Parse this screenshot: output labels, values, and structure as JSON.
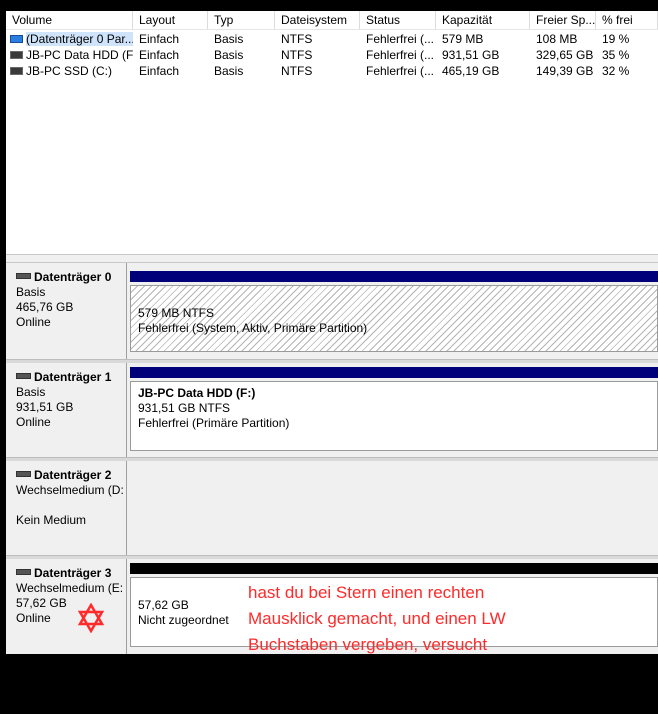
{
  "volume_list": {
    "columns": [
      "Volume",
      "Layout",
      "Typ",
      "Dateisystem",
      "Status",
      "Kapazität",
      "Freier Sp...",
      "% frei"
    ],
    "rows": [
      {
        "volume": "(Datenträger 0 Par...",
        "layout": "Einfach",
        "typ": "Basis",
        "dateisystem": "NTFS",
        "status": "Fehlerfrei (...",
        "kapazitaet": "579 MB",
        "frei": "108 MB",
        "prozent": "19 %",
        "icon": "volume-blue-icon"
      },
      {
        "volume": "JB-PC Data HDD (F:)",
        "layout": "Einfach",
        "typ": "Basis",
        "dateisystem": "NTFS",
        "status": "Fehlerfrei (...",
        "kapazitaet": "931,51 GB",
        "frei": "329,65 GB",
        "prozent": "35 %",
        "icon": "volume-drive-icon"
      },
      {
        "volume": "JB-PC SSD (C:)",
        "layout": "Einfach",
        "typ": "Basis",
        "dateisystem": "NTFS",
        "status": "Fehlerfrei (...",
        "kapazitaet": "465,19 GB",
        "frei": "149,39 GB",
        "prozent": "32 %",
        "icon": "volume-drive-icon"
      }
    ]
  },
  "disks": [
    {
      "name": "Datenträger 0",
      "type": "Basis",
      "size": "465,76 GB",
      "status": "Online",
      "partition": {
        "title": "",
        "line1": "579 MB NTFS",
        "line2": "Fehlerfrei (System, Aktiv, Primäre Partition)"
      }
    },
    {
      "name": "Datenträger 1",
      "type": "Basis",
      "size": "931,51 GB",
      "status": "Online",
      "partition": {
        "title": "JB-PC Data HDD  (F:)",
        "line1": "931,51 GB NTFS",
        "line2": "Fehlerfrei (Primäre Partition)"
      }
    },
    {
      "name": "Datenträger 2",
      "type": "Wechselmedium (D:",
      "size": "",
      "status": "Kein Medium"
    },
    {
      "name": "Datenträger 3",
      "type": "Wechselmedium (E:",
      "size": "57,62 GB",
      "status": "Online",
      "partition": {
        "line1": "57,62 GB",
        "line2": "Nicht zugeordnet"
      }
    }
  ],
  "annotation": {
    "text": "hast du bei Stern einen rechten\nMausklick gemacht, und einen LW\nBuchstaben vergeben, versucht",
    "color": "#ff2a2a",
    "marker_icon": "star-of-david-icon"
  },
  "colors": {
    "primary_bar": "#00007b",
    "unallocated_bar": "#000000",
    "background": "#f0f0f0"
  }
}
